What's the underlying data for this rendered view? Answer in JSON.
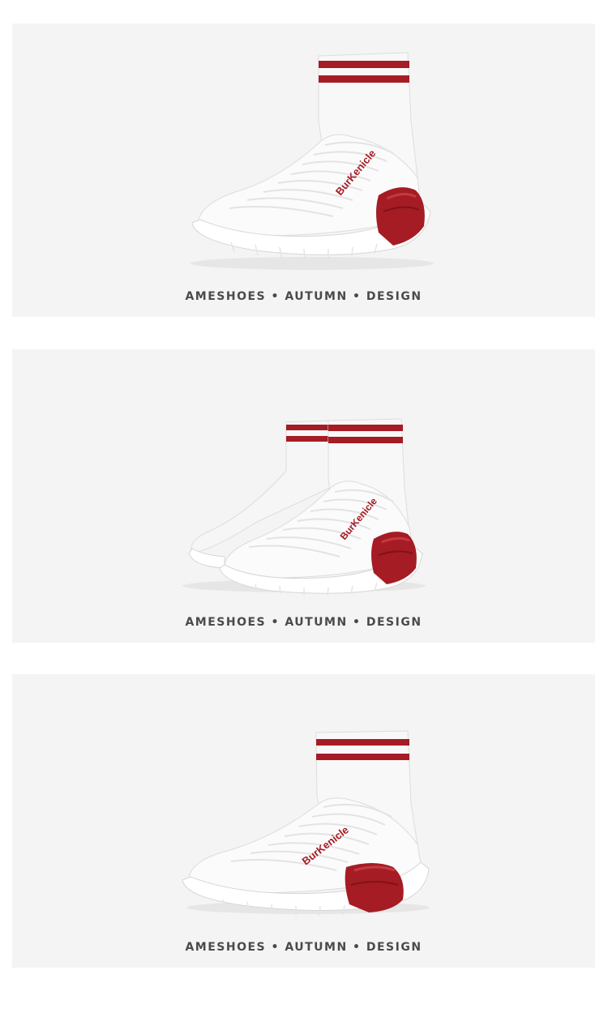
{
  "colors": {
    "panel_bg": "#f4f4f4",
    "accent_red": "#a51c24",
    "knit_white": "#ffffff",
    "caption_text": "#4a4a4a"
  },
  "panels": [
    {
      "view": "single-side",
      "brand": "BurKenicle",
      "caption": "AMESHOES • AUTUMN • DESIGN"
    },
    {
      "view": "pair-side",
      "brand": "BurKenicle",
      "caption": "AMESHOES • AUTUMN • DESIGN"
    },
    {
      "view": "single-side",
      "brand": "BurKenicle",
      "caption": "AMESHOES • AUTUMN • DESIGN"
    }
  ]
}
